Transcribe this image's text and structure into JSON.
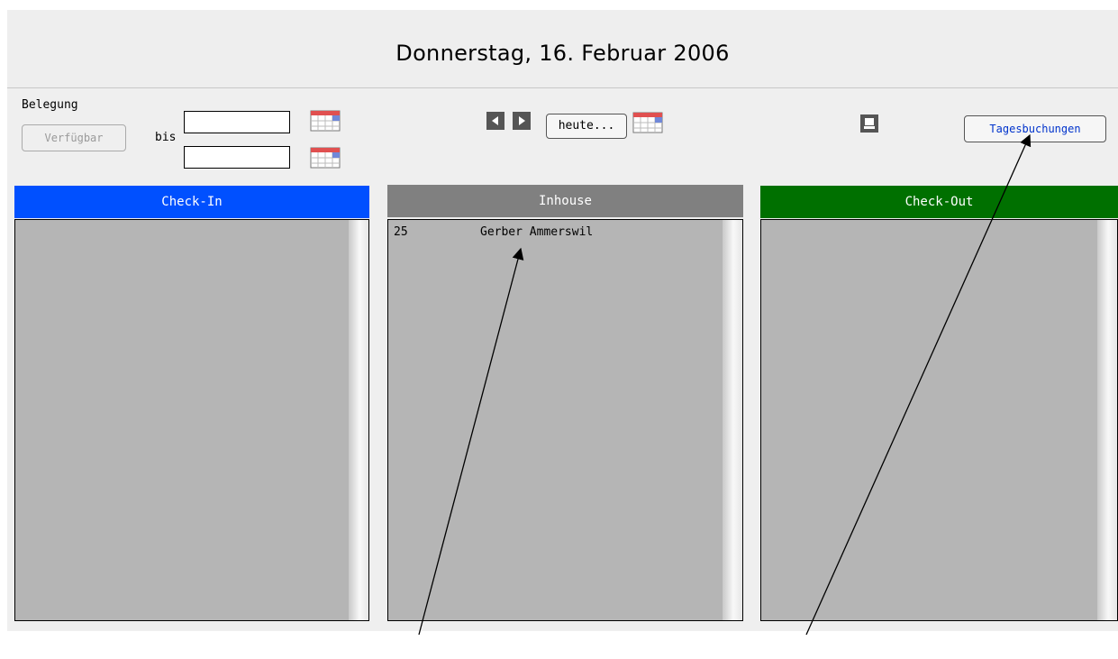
{
  "header": {
    "date_title": "Donnerstag, 16. Februar 2006"
  },
  "occupancy": {
    "label": "Belegung",
    "available_button": "Verfügbar",
    "to_label": "bis",
    "from_value": "",
    "to_value": ""
  },
  "nav": {
    "today_button": "heute..."
  },
  "actions": {
    "daily_bookings_button": "Tagesbuchungen"
  },
  "columns": {
    "checkin": {
      "label": "Check-In",
      "color": "#0050ff",
      "items": []
    },
    "inhouse": {
      "label": "Inhouse",
      "color": "#808080",
      "items": [
        {
          "room": "25",
          "guest": "Gerber Ammerswil"
        }
      ]
    },
    "checkout": {
      "label": "Check-Out",
      "color": "#007000",
      "items": []
    }
  }
}
